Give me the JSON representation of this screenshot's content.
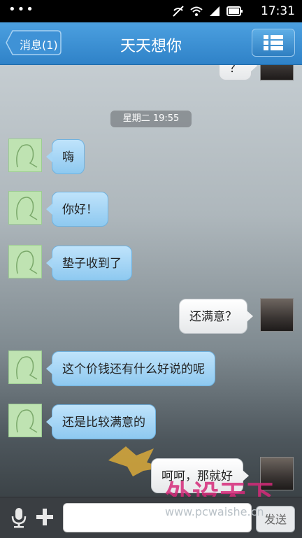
{
  "status_bar": {
    "dots": "•••",
    "time": "17:31",
    "icons": [
      "no-signal-icon",
      "wifi-icon",
      "cell-signal-icon",
      "battery-icon"
    ]
  },
  "header": {
    "back_label": "消息(1)",
    "title": "天天想你",
    "menu_icon": "list-menu-icon"
  },
  "chat": {
    "partial_top_message": "？",
    "timestamp": "星期二 19:55",
    "messages": [
      {
        "side": "left",
        "text": "嗨"
      },
      {
        "side": "left",
        "text": "你好！"
      },
      {
        "side": "left",
        "text": "垫子收到了"
      },
      {
        "side": "right",
        "text": "还满意？"
      },
      {
        "side": "left",
        "text": "这个价钱还有什么好说的呢"
      },
      {
        "side": "left",
        "text": "还是比较满意的"
      },
      {
        "side": "right",
        "text": "呵呵，那就好"
      }
    ]
  },
  "watermark": {
    "brand": "外设天下",
    "url": "www.pcwaishe.cn"
  },
  "input_bar": {
    "send_label": "发送",
    "input_value": ""
  },
  "colors": {
    "header": "#3a8fd6",
    "left_bubble": "#a6d6f5",
    "right_bubble": "#f1f2f3"
  }
}
